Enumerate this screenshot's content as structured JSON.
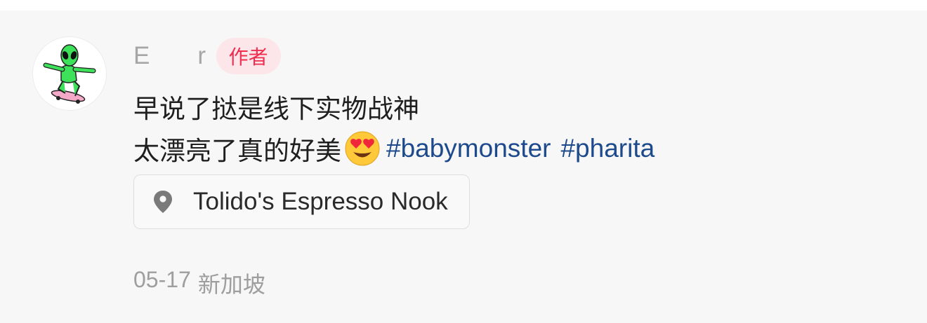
{
  "comment": {
    "username": "E         r",
    "author_badge": "作者",
    "line1": "早说了挞是线下实物战神",
    "line2_text": "太漂亮了真的好美",
    "emoji": "heart-eyes-emoji",
    "hashtags": [
      "#babymonster",
      "#pharita"
    ],
    "location": "Tolido's Espresso Nook",
    "date": "05-17",
    "region": "新加坡"
  },
  "colors": {
    "background": "#f7f7f7",
    "hashtag": "#1d4a8c",
    "author_badge_text": "#ee2d4f",
    "author_badge_bg": "#fde6e9",
    "muted": "#9e9e9e"
  }
}
